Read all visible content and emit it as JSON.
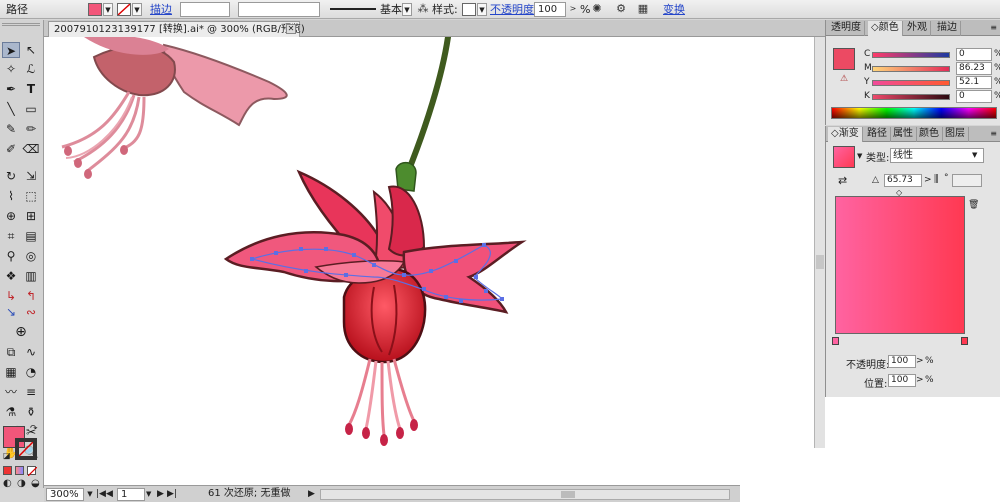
{
  "control_bar": {
    "object_type": "路径",
    "fill_color": "#f2567a",
    "stroke_label": "描边",
    "stroke_value": "",
    "profile_label": "基本",
    "style_label": "样式:",
    "opacity_label": "不透明度",
    "opacity_value": "100",
    "opacity_unit": "%",
    "transform_label": "变换"
  },
  "document": {
    "tab_title": "20079101231391​77 [转换].ai* @ 300% (RGB/预览)"
  },
  "tools": [
    "selection-tool",
    "direct-selection-tool",
    "magic-wand-tool",
    "lasso-tool",
    "pen-tool",
    "type-tool",
    "line-tool",
    "rectangle-tool",
    "paintbrush-tool",
    "pencil-tool",
    "blob-brush-tool",
    "eraser-tool",
    "rotate-tool",
    "scale-tool",
    "warp-tool",
    "free-transform-tool",
    "shape-builder-tool",
    "perspective-tool",
    "mesh-tool",
    "gradient-tool",
    "eyedropper-tool",
    "blend-tool",
    "symbol-sprayer-tool",
    "column-graph-tool",
    "artboard-tool",
    "slice-tool",
    "hand-tool",
    "zoom-tool"
  ],
  "tool_colors": {
    "fill": "#f2567a",
    "stroke": "none"
  },
  "status_bar": {
    "zoom": "300%",
    "page": "1",
    "message": "61 次还原; 无重做"
  },
  "color_panel": {
    "tabs": [
      "透明度",
      "颜色",
      "外观",
      "描边"
    ],
    "active_tab": "颜色",
    "swatch": "#ec4a63",
    "rows": [
      {
        "label": "C",
        "value": "0",
        "unit": "%"
      },
      {
        "label": "M",
        "value": "86.23",
        "unit": "%"
      },
      {
        "label": "Y",
        "value": "52.1",
        "unit": "%"
      },
      {
        "label": "K",
        "value": "0",
        "unit": "%"
      }
    ]
  },
  "gradient_panel": {
    "tabs": [
      "渐变",
      "路径",
      "属性",
      "颜色",
      "图层"
    ],
    "active_tab": "渐变",
    "type_label": "类型:",
    "type_value": "线性",
    "angle_value": "65.73",
    "angle_unit": "°",
    "start_color": "#ff63a1",
    "end_color": "#ff3952",
    "opacity_label": "不透明度:",
    "opacity_value": "100",
    "position_label": "位置:",
    "position_value": "100",
    "unit": "%"
  }
}
